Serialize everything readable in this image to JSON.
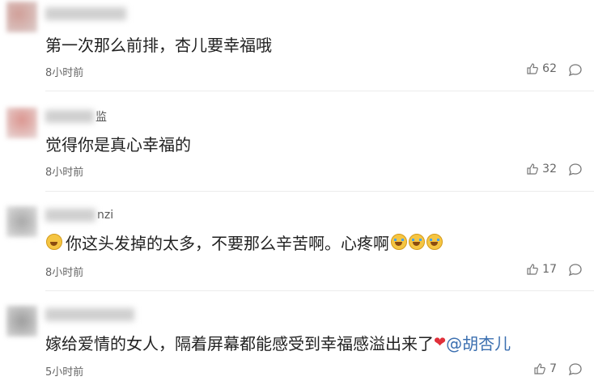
{
  "comments": [
    {
      "username": "",
      "text": "第一次那么前排，杏儿要幸福哦",
      "time": "8小时前",
      "likes": "62"
    },
    {
      "username": "监",
      "text": "觉得你是真心幸福的",
      "time": "8小时前",
      "likes": "32"
    },
    {
      "username": "nzi",
      "text": "你这头发掉的太多，不要那么辛苦啊。心疼啊",
      "time": "8小时前",
      "likes": "17"
    },
    {
      "username": "",
      "text": "嫁给爱情的女人，隔着屏幕都能感受到幸福感溢出来了",
      "mention": "@胡杏儿",
      "time": "5小时前",
      "likes": "7"
    }
  ],
  "icons": {
    "like": "thumbs-up-icon",
    "reply": "comment-bubble-icon",
    "heart": "heart-icon",
    "emoji": "crying-face-emoji"
  },
  "colors": {
    "mention": "#3b6fb0",
    "heart": "#e0303a"
  }
}
